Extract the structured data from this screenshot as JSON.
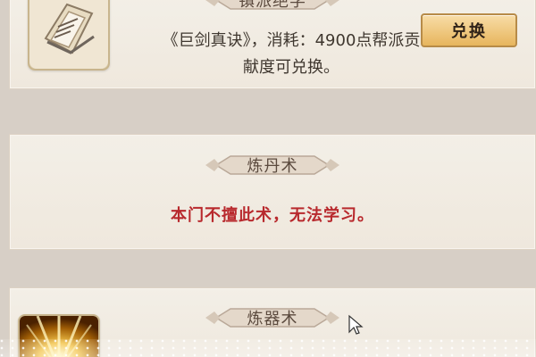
{
  "sections": [
    {
      "title": "镇派绝学",
      "description": "《巨剑真诀》，消耗：4900点帮派贡献度可兑换。",
      "button_label": "兑换",
      "icon": "book-icon"
    },
    {
      "title": "炼丹术",
      "warning": "本门不擅此术，无法学习。"
    },
    {
      "title": "炼器术",
      "icon": "golden-light-icon"
    }
  ],
  "colors": {
    "warning": "#b8292d",
    "button": "#e7b55d"
  }
}
